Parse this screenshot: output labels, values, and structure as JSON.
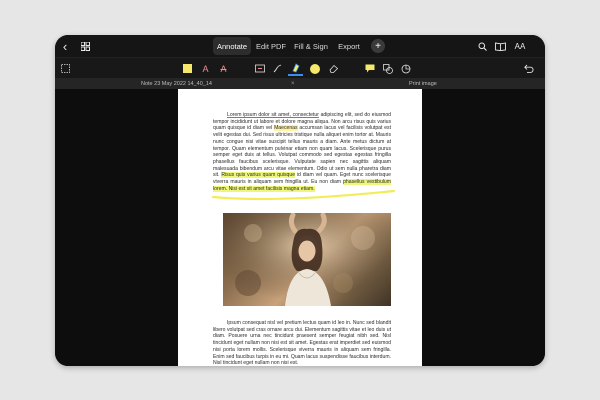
{
  "topbar": {
    "tabs": [
      {
        "label": "Annotate",
        "active": true
      },
      {
        "label": "Edit PDF",
        "active": false
      },
      {
        "label": "Fill & Sign",
        "active": false
      },
      {
        "label": "Export",
        "active": false
      }
    ],
    "add_label": "+",
    "back_glyph": "‹",
    "aa_label": "AA"
  },
  "toolbar": {
    "accent_color": "#3b8ef0",
    "highlight_color": "#f5e86a",
    "text_a_glyph": "A"
  },
  "docbar": {
    "note_tab": "Note 23 May 2022 14_40_14",
    "close_glyph": "×",
    "print_tab": "Print image"
  },
  "page": {
    "p1": {
      "intro_underlined": "Lorem ipsum dolor sit amet, consectetur",
      "intro_rest": " adipiscing elit, sed do eiusmod tempor incididunt ut labore et dolore magna aliqua. Non arcu risus quis varius quam quisque id diam vel ",
      "hl_word": "Maecenas",
      "middle": " accumsan lacus vel facilisis volutpat est velit egestas dui. Sed risus ultricies tristique nulla aliquet enim tortor at. Mauris nunc congue nisi vitae suscipit tellus mauris a diam. Ante metus dictum at tempor. Quam elementum pulvinar etiam non quam lacus. Scelerisque purus semper eget duis at tellus. Volutpat commodo sed egestas egestas fringilla phasellus faucibus scelerisque. Vulputate sapien nec sagittis aliquam malesuada bibendum arcu vitae elementum. Odio ut sem nulla pharetra diam sit. ",
      "hl_phrase1": "Risus quis varius quam quisque",
      "after1": " id diam vel quam. Eget nunc scelerisque viverra mauris in aliquam sem fringilla ut. Eu non diam ",
      "hl_phrase2": "phasellus vestibulum lorem. Nisi est sit amet facilisis magna etiam.",
      "end": ""
    },
    "p2": "Ipsum consequat nisl vel pretium lectus quam id leo in. Nunc sed blandit libero volutpat sed cras ornare arcu dui. Elementum sagittis vitae et leo duis ut diam. Posuere urna nec tincidunt praesent semper feugiat nibh sed. Nisl tincidunt eget nullam non nisi est sit amet. Egestas erat imperdiet sed euismod nisi porta lorem mollis. Scelerisque viverra mauris in aliquam sem fringilla. Enim sed faucibus turpis in eu mi. Quam lacus suspendisse faucibus interdum. Nisl tincidunt eget nullam non nisi est."
  }
}
